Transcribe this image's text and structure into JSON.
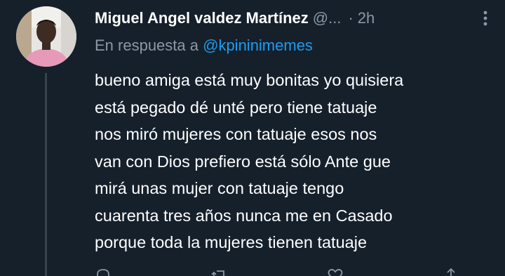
{
  "tweet": {
    "author_name": "Miguel Angel valdez Martínez",
    "handle": "@...",
    "separator": "·",
    "time": "2h",
    "reply_prefix": "En respuesta a",
    "reply_mention": "@kpininimemes",
    "text": "bueno amiga está muy bonitas yo quisiera\nestá pegado dé unté pero tiene tatuaje\nnos miró mujeres con tatuaje esos nos\nvan con Dios prefiero está sólo Ante gue\nmirá unas mujer con tatuaje tengo\ncuarenta tres años nunca me en Casado\nporque toda la mujeres tienen tatuaje"
  },
  "icons": {
    "more": "more-horizontal-icon",
    "reply": "reply-icon",
    "retweet": "retweet-icon",
    "like": "like-icon",
    "share": "share-icon"
  },
  "colors": {
    "background": "#15202b",
    "text": "#ffffff",
    "secondary": "#8b98a5",
    "accent": "#1d9bf0"
  }
}
